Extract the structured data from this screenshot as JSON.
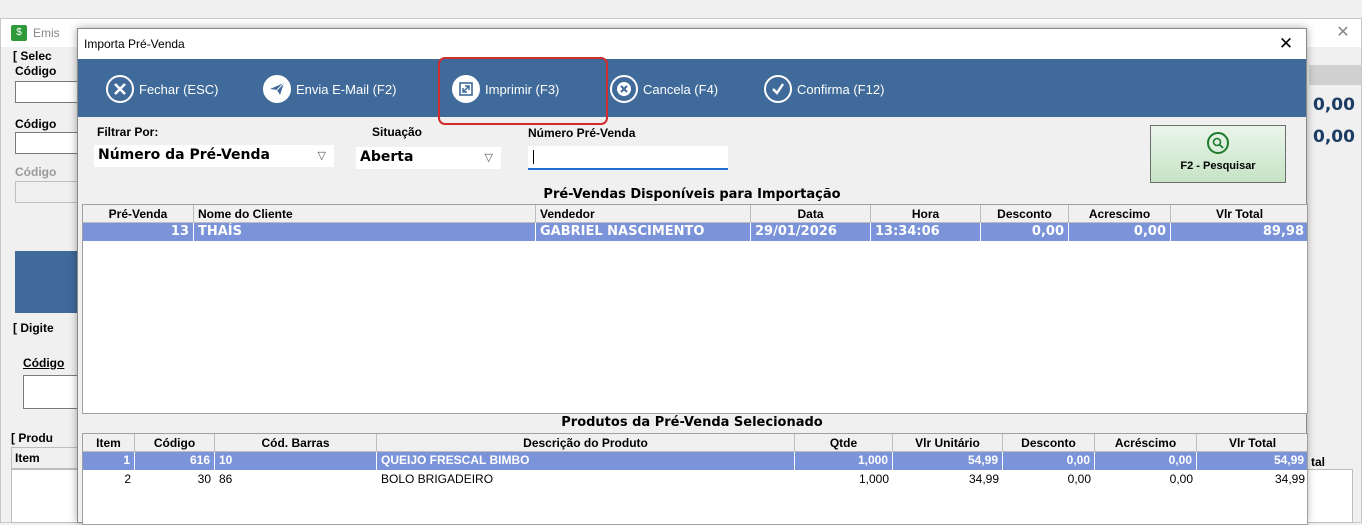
{
  "background": {
    "title": "Emis",
    "close": "✕",
    "labels": {
      "select": "[ Selec",
      "codigo1": "Código",
      "codigo2": "Código",
      "codigo3": "Código",
      "digite": "[ Digite",
      "codigo4": "Código",
      "produ": "[ Produ",
      "item": "Item",
      "tal": "tal"
    },
    "values": {
      "v1": "0,00",
      "v2": "0,00"
    },
    "colors": {
      "blue_panel": "#3f6a99"
    }
  },
  "dialog": {
    "title": "Importa Pré-Venda",
    "close": "✕",
    "toolbar": {
      "background": "#3f6a99",
      "buttons": [
        {
          "label": "Fechar (ESC)",
          "icon": "close-circle-icon"
        },
        {
          "label": "Envia E-Mail (F2)",
          "icon": "send-email-icon"
        },
        {
          "label": "Imprimir (F3)",
          "icon": "print-expand-icon"
        },
        {
          "label": "Cancela (F4)",
          "icon": "cancel-circle-icon"
        },
        {
          "label": "Confirma (F12)",
          "icon": "check-circle-icon"
        }
      ]
    },
    "filters": {
      "filtrar_label": "Filtrar Por:",
      "filtrar_value": "Número da Pré-Venda",
      "situacao_label": "Situação",
      "situacao_value": "Aberta",
      "numero_label": "Número Pré-Venda",
      "numero_value": ""
    },
    "search_button": "F2 - Pesquisar",
    "prevendas": {
      "title": "Pré-Vendas Disponíveis para Importação",
      "columns": [
        "Pré-Venda",
        "Nome do Cliente",
        "Vendedor",
        "Data",
        "Hora",
        "Desconto",
        "Acrescimo",
        "Vlr Total"
      ],
      "rows": [
        [
          "13",
          "THAÍS",
          "GABRIEL NASCIMENTO",
          "29/01/2026",
          "13:34:06",
          "0,00",
          "0,00",
          "89,98"
        ]
      ]
    },
    "produtos": {
      "title": "Produtos da Pré-Venda Selecionado",
      "columns": [
        "Item",
        "Código",
        "Cód. Barras",
        "Descrição do Produto",
        "Qtde",
        "Vlr Unitário",
        "Desconto",
        "Acréscimo",
        "Vlr Total"
      ],
      "rows": [
        [
          "1",
          "616",
          "10",
          "QUEIJO FRESCAL BIMBO",
          "1,000",
          "54,99",
          "0,00",
          "0,00",
          "54,99"
        ],
        [
          "2",
          "30",
          "86",
          "BOLO BRIGADEIRO",
          "1,000",
          "34,99",
          "0,00",
          "0,00",
          "34,99"
        ]
      ]
    },
    "highlight_color": "#d22c2c",
    "selected_row_color": "#7b93d9"
  }
}
